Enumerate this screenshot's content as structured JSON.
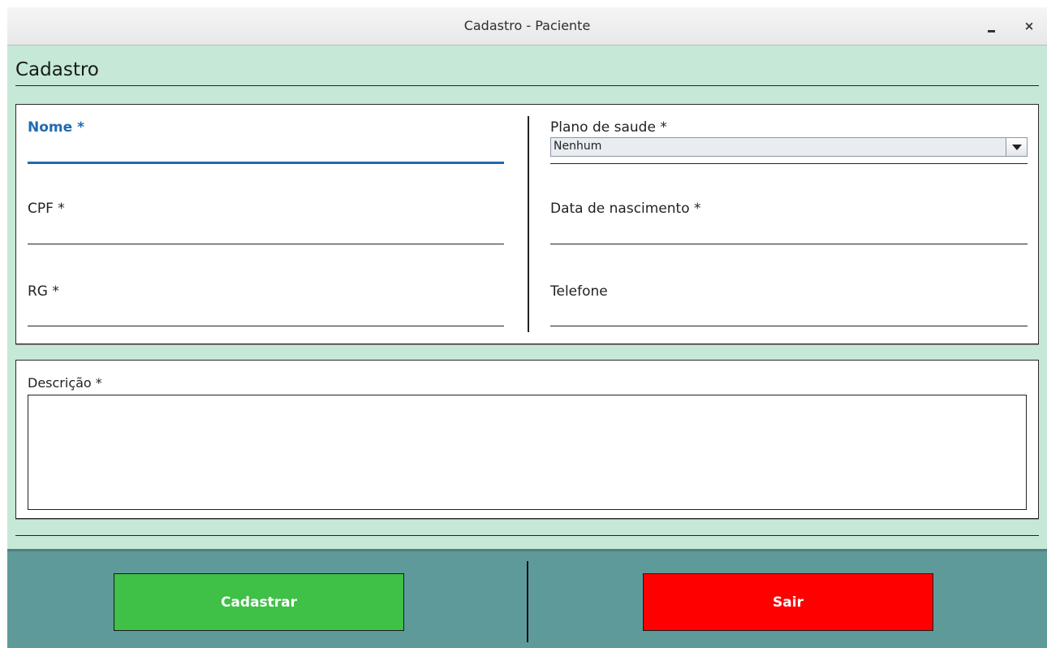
{
  "window": {
    "title": "Cadastro - Paciente",
    "minimize_label": "",
    "close_label": "×"
  },
  "section": {
    "title": "Cadastro"
  },
  "form": {
    "nome_label": "Nome *",
    "nome_value": "",
    "cpf_label": "CPF *",
    "cpf_value": "",
    "rg_label": "RG *",
    "rg_value": "",
    "plano_label": "Plano de saude *",
    "plano_selected": "Nenhum",
    "nascimento_label": "Data de nascimento *",
    "nascimento_value": "",
    "telefone_label": "Telefone",
    "telefone_value": "",
    "descricao_label": "Descrição *",
    "descricao_value": ""
  },
  "actions": {
    "cadastrar_label": "Cadastrar",
    "sair_label": "Sair"
  },
  "colors": {
    "background": "#c5e9d6",
    "accent_active": "#1f6bb0",
    "footer": "#5f9a9a",
    "cadastrar": "#3fc046",
    "sair": "#ff0000"
  }
}
